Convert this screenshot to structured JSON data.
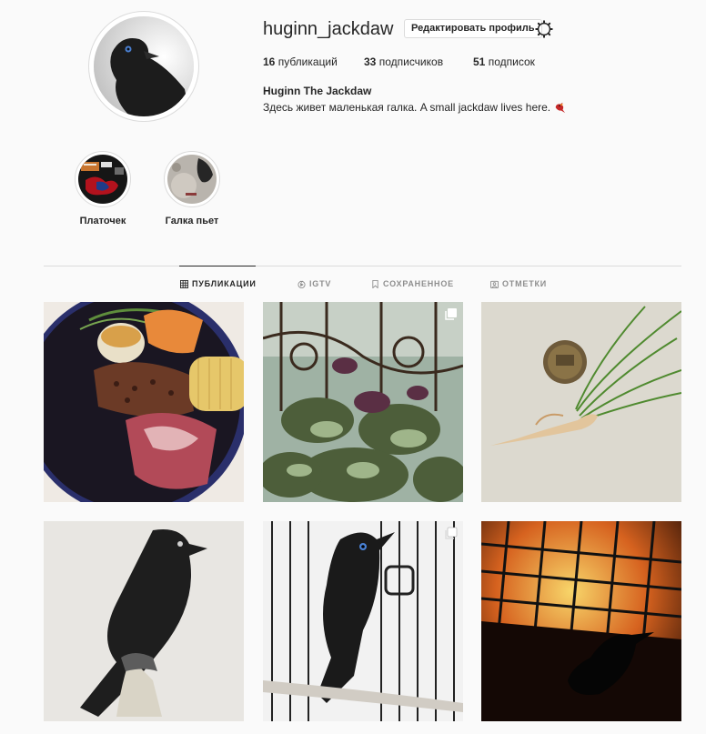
{
  "profile": {
    "username": "huginn_jackdaw",
    "edit_label": "Редактировать профиль",
    "posts_count": "16",
    "posts_label": "публикаций",
    "followers_count": "33",
    "followers_label": "подписчиков",
    "following_count": "51",
    "following_label": "подписок",
    "full_name": "Huginn The Jackdaw",
    "bio": "Здесь живет маленькая галка. A small jackdaw lives here."
  },
  "highlights": [
    {
      "label": "Платочек"
    },
    {
      "label": "Галка пьет"
    }
  ],
  "tabs": [
    {
      "label": "ПУБЛИКАЦИИ",
      "icon": "grid-icon",
      "active": true
    },
    {
      "label": "IGTV",
      "icon": "igtv-icon",
      "active": false
    },
    {
      "label": "СОХРАНЕННОЕ",
      "icon": "bookmark-icon",
      "active": false
    },
    {
      "label": "ОТМЕТКИ",
      "icon": "tagged-icon",
      "active": false
    }
  ],
  "posts": [
    {
      "subject": "food-bowl"
    },
    {
      "subject": "basil-balcony",
      "multi": true
    },
    {
      "subject": "coin-sprout"
    },
    {
      "subject": "jackdaw-perch"
    },
    {
      "subject": "jackdaw-cage",
      "multi": true
    },
    {
      "subject": "cage-silhouette"
    }
  ]
}
